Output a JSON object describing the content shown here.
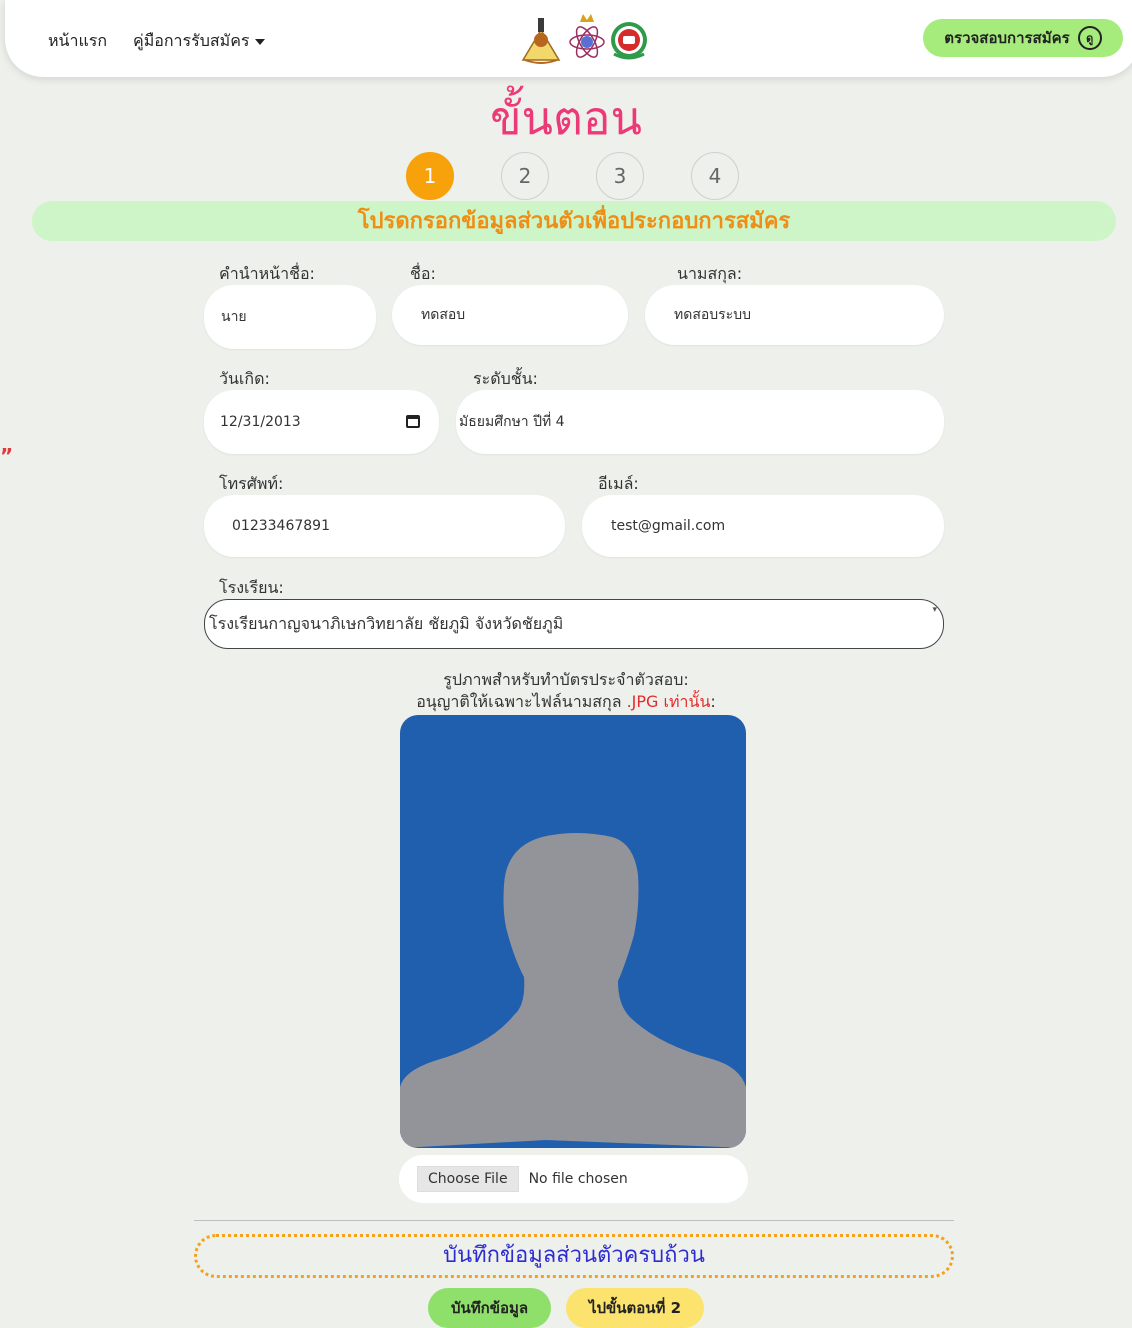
{
  "nav": {
    "home": "หน้าแรก",
    "guide": "คู่มือการรับสมัคร",
    "check_button": "ตรวจสอบการสมัคร",
    "check_icon_text": "ดู"
  },
  "stray_mark": "”",
  "page_title": "ขั้นตอน",
  "steps": [
    "1",
    "2",
    "3",
    "4"
  ],
  "active_step": 1,
  "section_title": "โปรดกรอกข้อมูลส่วนตัวเพื่อประกอบการสมัคร",
  "form": {
    "prefix_label": "คำนำหน้าชื่อ:",
    "prefix_value": "นาย",
    "firstname_label": "ชื่อ:",
    "firstname_value": "ทดสอบ",
    "lastname_label": "นามสกุล:",
    "lastname_value": "ทดสอบระบบ",
    "birthdate_label": "วันเกิด:",
    "birthdate_value": "12/31/2013",
    "grade_label": "ระดับชั้น:",
    "grade_value": "มัธยมศึกษา ปีที่ 4",
    "phone_label": "โทรศัพท์:",
    "phone_value": "01233467891",
    "email_label": "อีเมล์:",
    "email_value": "test@gmail.com",
    "school_label": "โรงเรียน:",
    "school_value": "โรงเรียนกาญจนาภิเษกวิทยาลัย ชัยภูมิ จังหวัดชัยภูมิ"
  },
  "photo": {
    "caption_line1": "รูปภาพสำหรับทำบัตรประจำตัวสอบ:",
    "caption_line2_prefix": "อนุญาติให้เฉพาะไฟล์นามสกุล ",
    "caption_line2_highlight": ".JPG เท่านั้น",
    "caption_line2_suffix": ":",
    "choose_file": "Choose File",
    "no_file": "No file chosen"
  },
  "complete_message": "บันทึกข้อมูลส่วนตัวครบถ้วน",
  "buttons": {
    "save": "บันทึกข้อมูล",
    "next": "ไปขั้นตอนที่ 2"
  },
  "colors": {
    "title": "#ec3a78",
    "active_step": "#f7a10b",
    "section_banner_bg": "#cdf5c8",
    "section_banner_text": "#ef8d14",
    "check_button": "#a6ec7c",
    "save_button": "#8ee06b",
    "next_button": "#fbe36d",
    "photo_bg": "#1f5fae",
    "photo_silhouette": "#939499",
    "complete_text": "#2d2bd1",
    "complete_border": "#f4a21d"
  }
}
